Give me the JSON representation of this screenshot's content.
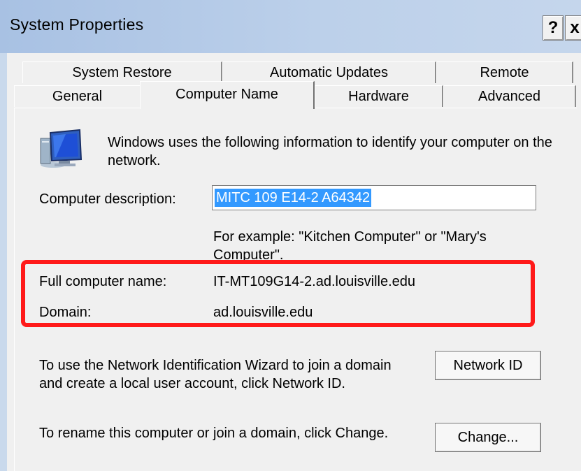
{
  "window": {
    "title": "System Properties",
    "help_label": "?",
    "close_label": "x"
  },
  "tabs": {
    "row1": [
      "System Restore",
      "Automatic Updates",
      "Remote"
    ],
    "row2": [
      "General",
      "Computer Name",
      "Hardware",
      "Advanced"
    ],
    "active": "Computer Name"
  },
  "panel": {
    "intro": "Windows uses the following information to identify your computer on the network.",
    "description_label": "Computer description:",
    "description_value": "MITC 109 E14-2 A64342",
    "example_text": "For example: \"Kitchen Computer\" or \"Mary's Computer\".",
    "full_name_label": "Full computer name:",
    "full_name_value": "IT-MT109G14-2.ad.louisville.edu",
    "domain_label": "Domain:",
    "domain_value": "ad.louisville.edu",
    "network_id_text": "To use the Network Identification Wizard to join a domain and create a local user account, click Network ID.",
    "network_id_button": "Network ID",
    "rename_text": "To rename this computer or join a domain, click Change.",
    "change_button": "Change..."
  },
  "colors": {
    "highlight": "#ff1a1a",
    "selection": "#3399ff"
  }
}
